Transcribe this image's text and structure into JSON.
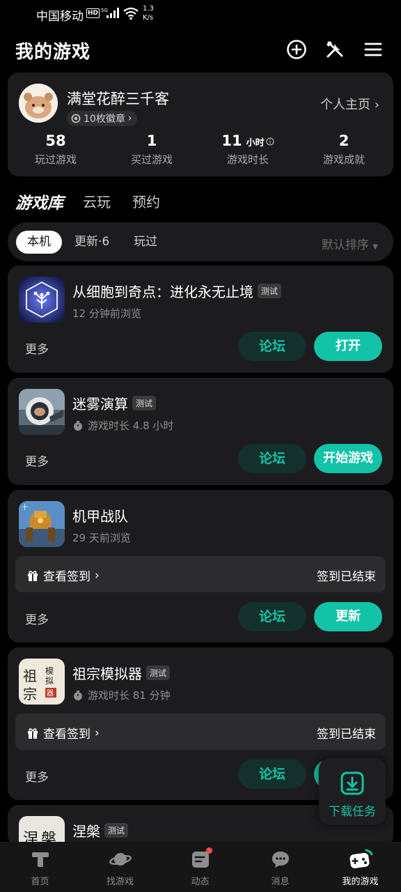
{
  "status_bar": {
    "carrier": "中国移动",
    "hd": "HD",
    "network": "5G",
    "speed_value": "1.3",
    "speed_unit": "K/s"
  },
  "header": {
    "title": "我的游戏",
    "icons": [
      "add-circle-icon",
      "tools-icon",
      "menu-icon"
    ]
  },
  "profile": {
    "username": "满堂花醉三千客",
    "badge": "10枚徽章",
    "home_link": "个人主页",
    "stats": [
      {
        "value": "58",
        "unit": "",
        "label": "玩过游戏"
      },
      {
        "value": "1",
        "unit": "",
        "label": "买过游戏"
      },
      {
        "value": "11",
        "unit": "小时",
        "label": "游戏时长"
      },
      {
        "value": "2",
        "unit": "",
        "label": "游戏成就"
      }
    ]
  },
  "library_tabs": [
    {
      "label": "游戏库",
      "active": true
    },
    {
      "label": "云玩",
      "active": false
    },
    {
      "label": "预约",
      "active": false
    }
  ],
  "filters": [
    {
      "label": "本机",
      "active": true
    },
    {
      "label": "更新·6",
      "active": false
    },
    {
      "label": "玩过",
      "active": false
    }
  ],
  "sort": "默认排序",
  "games": [
    {
      "name": "从细胞到奇点：进化永无止境",
      "tag": "测试",
      "subtitle": "12 分钟前浏览",
      "has_timer": false,
      "checkin": null,
      "more": "更多",
      "forum": "论坛",
      "action": "打开"
    },
    {
      "name": "迷雾演算",
      "tag": "测试",
      "subtitle": "游戏时长 4.8 小时",
      "has_timer": true,
      "checkin": null,
      "more": "更多",
      "forum": "论坛",
      "action": "开始游戏"
    },
    {
      "name": "机甲战队",
      "tag": "",
      "subtitle": "29 天前浏览",
      "has_timer": false,
      "checkin": {
        "left": "查看签到",
        "right": "签到已结束"
      },
      "more": "更多",
      "forum": "论坛",
      "action": "更新"
    },
    {
      "name": "祖宗模拟器",
      "tag": "测试",
      "subtitle": "游戏时长 81 分钟",
      "has_timer": true,
      "checkin": {
        "left": "查看签到",
        "right": "签到已结束"
      },
      "more": "更多",
      "forum": "论坛",
      "action": ""
    },
    {
      "name": "涅槃",
      "tag": "测试",
      "subtitle": "",
      "has_timer": false,
      "checkin": null,
      "more": "",
      "forum": "",
      "action": ""
    }
  ],
  "download_float": {
    "label": "下载任务"
  },
  "bottom_nav": [
    {
      "label": "首页",
      "icon": "home-icon",
      "active": false
    },
    {
      "label": "找游戏",
      "icon": "planet-icon",
      "active": false
    },
    {
      "label": "动态",
      "icon": "feed-icon",
      "active": false,
      "dot": true
    },
    {
      "label": "消息",
      "icon": "message-icon",
      "active": false
    },
    {
      "label": "我的游戏",
      "icon": "gamepad-icon",
      "active": true
    }
  ],
  "colors": {
    "accent": "#12c3a8",
    "card_bg": "#1c1c1e",
    "page_bg": "#000000",
    "forum_bg": "#13302c",
    "notify_dot": "#ff4b4b"
  }
}
